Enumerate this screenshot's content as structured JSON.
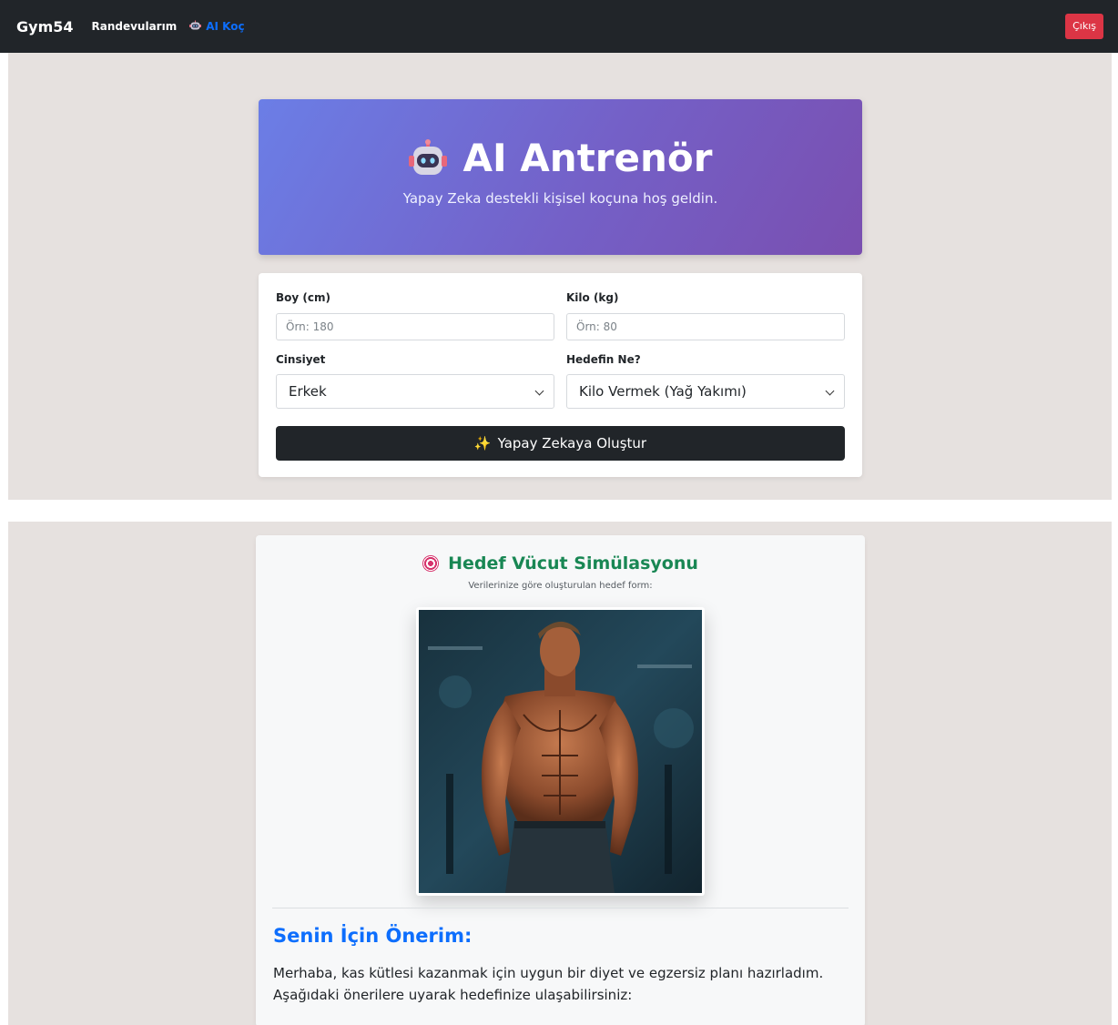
{
  "navbar": {
    "brand": "Gym54",
    "links": [
      {
        "label": "Randevularım"
      },
      {
        "label": "AI Koç",
        "icon": "robot-icon"
      }
    ],
    "logout_label": "Çıkış",
    "colors": {
      "bg": "#212529",
      "active_link": "#0d6efd",
      "logout": "#dc3545"
    }
  },
  "hero": {
    "title": "AI Antrenör",
    "icon": "robot-icon",
    "subtitle": "Yapay Zeka destekli kişisel koçuna hoş geldin."
  },
  "form": {
    "height": {
      "label": "Boy (cm)",
      "placeholder": "Örn: 180",
      "value": ""
    },
    "weight": {
      "label": "Kilo (kg)",
      "placeholder": "Örn: 80",
      "value": ""
    },
    "gender": {
      "label": "Cinsiyet",
      "selected": "Erkek"
    },
    "goal": {
      "label": "Hedefin Ne?",
      "selected": "Kilo Vermek (Yağ Yakımı)"
    },
    "submit_label": "Yapay Zekaya Oluştur",
    "submit_icon": "sparkles-icon"
  },
  "result": {
    "title": "Hedef Vücut Simülasyonu",
    "title_icon": "target-icon",
    "subtitle": "Verilerinize göre oluşturulan hedef form:",
    "recommendation_title": "Senin İçin Önerim:",
    "recommendation_text": "Merhaba, kas kütlesi kazanmak için uygun bir diyet ve egzersiz planı hazırladım. Aşağıdaki önerilere uyarak hedefinize ulaşabilirsiniz:",
    "colors": {
      "title": "#198754",
      "recommendation_title": "#0d6efd"
    }
  }
}
